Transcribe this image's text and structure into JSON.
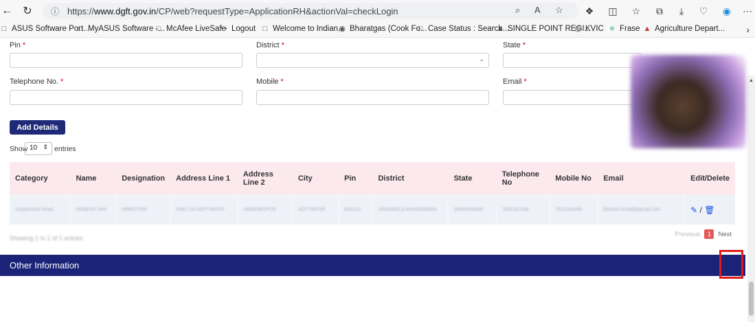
{
  "browser": {
    "url_prefix": "https://",
    "url_domain": "www.dgft.gov.in",
    "url_path": "/CP/web?requestType=ApplicationRH&actionVal=checkLogin"
  },
  "bookmarks": [
    {
      "label": "ASUS Software Port..."
    },
    {
      "label": "MyASUS Software -..."
    },
    {
      "label": "McAfee LiveSafe"
    },
    {
      "label": "Logout"
    },
    {
      "label": "Welcome to Indian..."
    },
    {
      "label": "Bharatgas (Cook Fo..."
    },
    {
      "label": "Case Status : Search..."
    },
    {
      "label": "SINGLE POINT REGI..."
    },
    {
      "label": "KVIC"
    },
    {
      "label": "Frase"
    },
    {
      "label": "Agriculture Depart..."
    }
  ],
  "form": {
    "pin_label": "Pin",
    "district_label": "District",
    "state_label": "State",
    "telephone_label": "Telephone No.",
    "mobile_label": "Mobile",
    "email_label": "Email",
    "required_mark": "*",
    "add_button": "Add Details"
  },
  "table_controls": {
    "show_label": "Show",
    "page_size": "10",
    "entries_label": "entries",
    "showing_text": "Showing 1 to 1 of 1 entries",
    "prev_label": "Previous",
    "current_page": "1",
    "next_label": "Next"
  },
  "table": {
    "headers": [
      "Category",
      "Name",
      "Designation",
      "Address Line 1",
      "Address Line 2",
      "City",
      "Pin",
      "District",
      "State",
      "Telephone No",
      "Mobile No",
      "Email",
      "Edit/Delete"
    ],
    "row": [
      "Department Head",
      "GANESH JHA",
      "DIRECTOR",
      "HNO 124 ADITYAPUR",
      "JAMSHEDPUR",
      "ADITYAPUR",
      "831013",
      "SARAIKELA KHARSAWAN",
      "JHARKHAND",
      "7631181448",
      "7631181448",
      "[blurred email]@gmail.com"
    ],
    "edit_icon": "pencil-icon",
    "delete_icon": "trash-icon",
    "separator": "/"
  },
  "section": {
    "other_info": "Other Information"
  },
  "colors": {
    "navy": "#1a2378",
    "button": "#1e2a78",
    "header_row": "#fce9ee",
    "data_row": "#eef2f8",
    "required": "#c00",
    "highlight_box": "#e01b1b",
    "page_active": "#e25b5b"
  }
}
